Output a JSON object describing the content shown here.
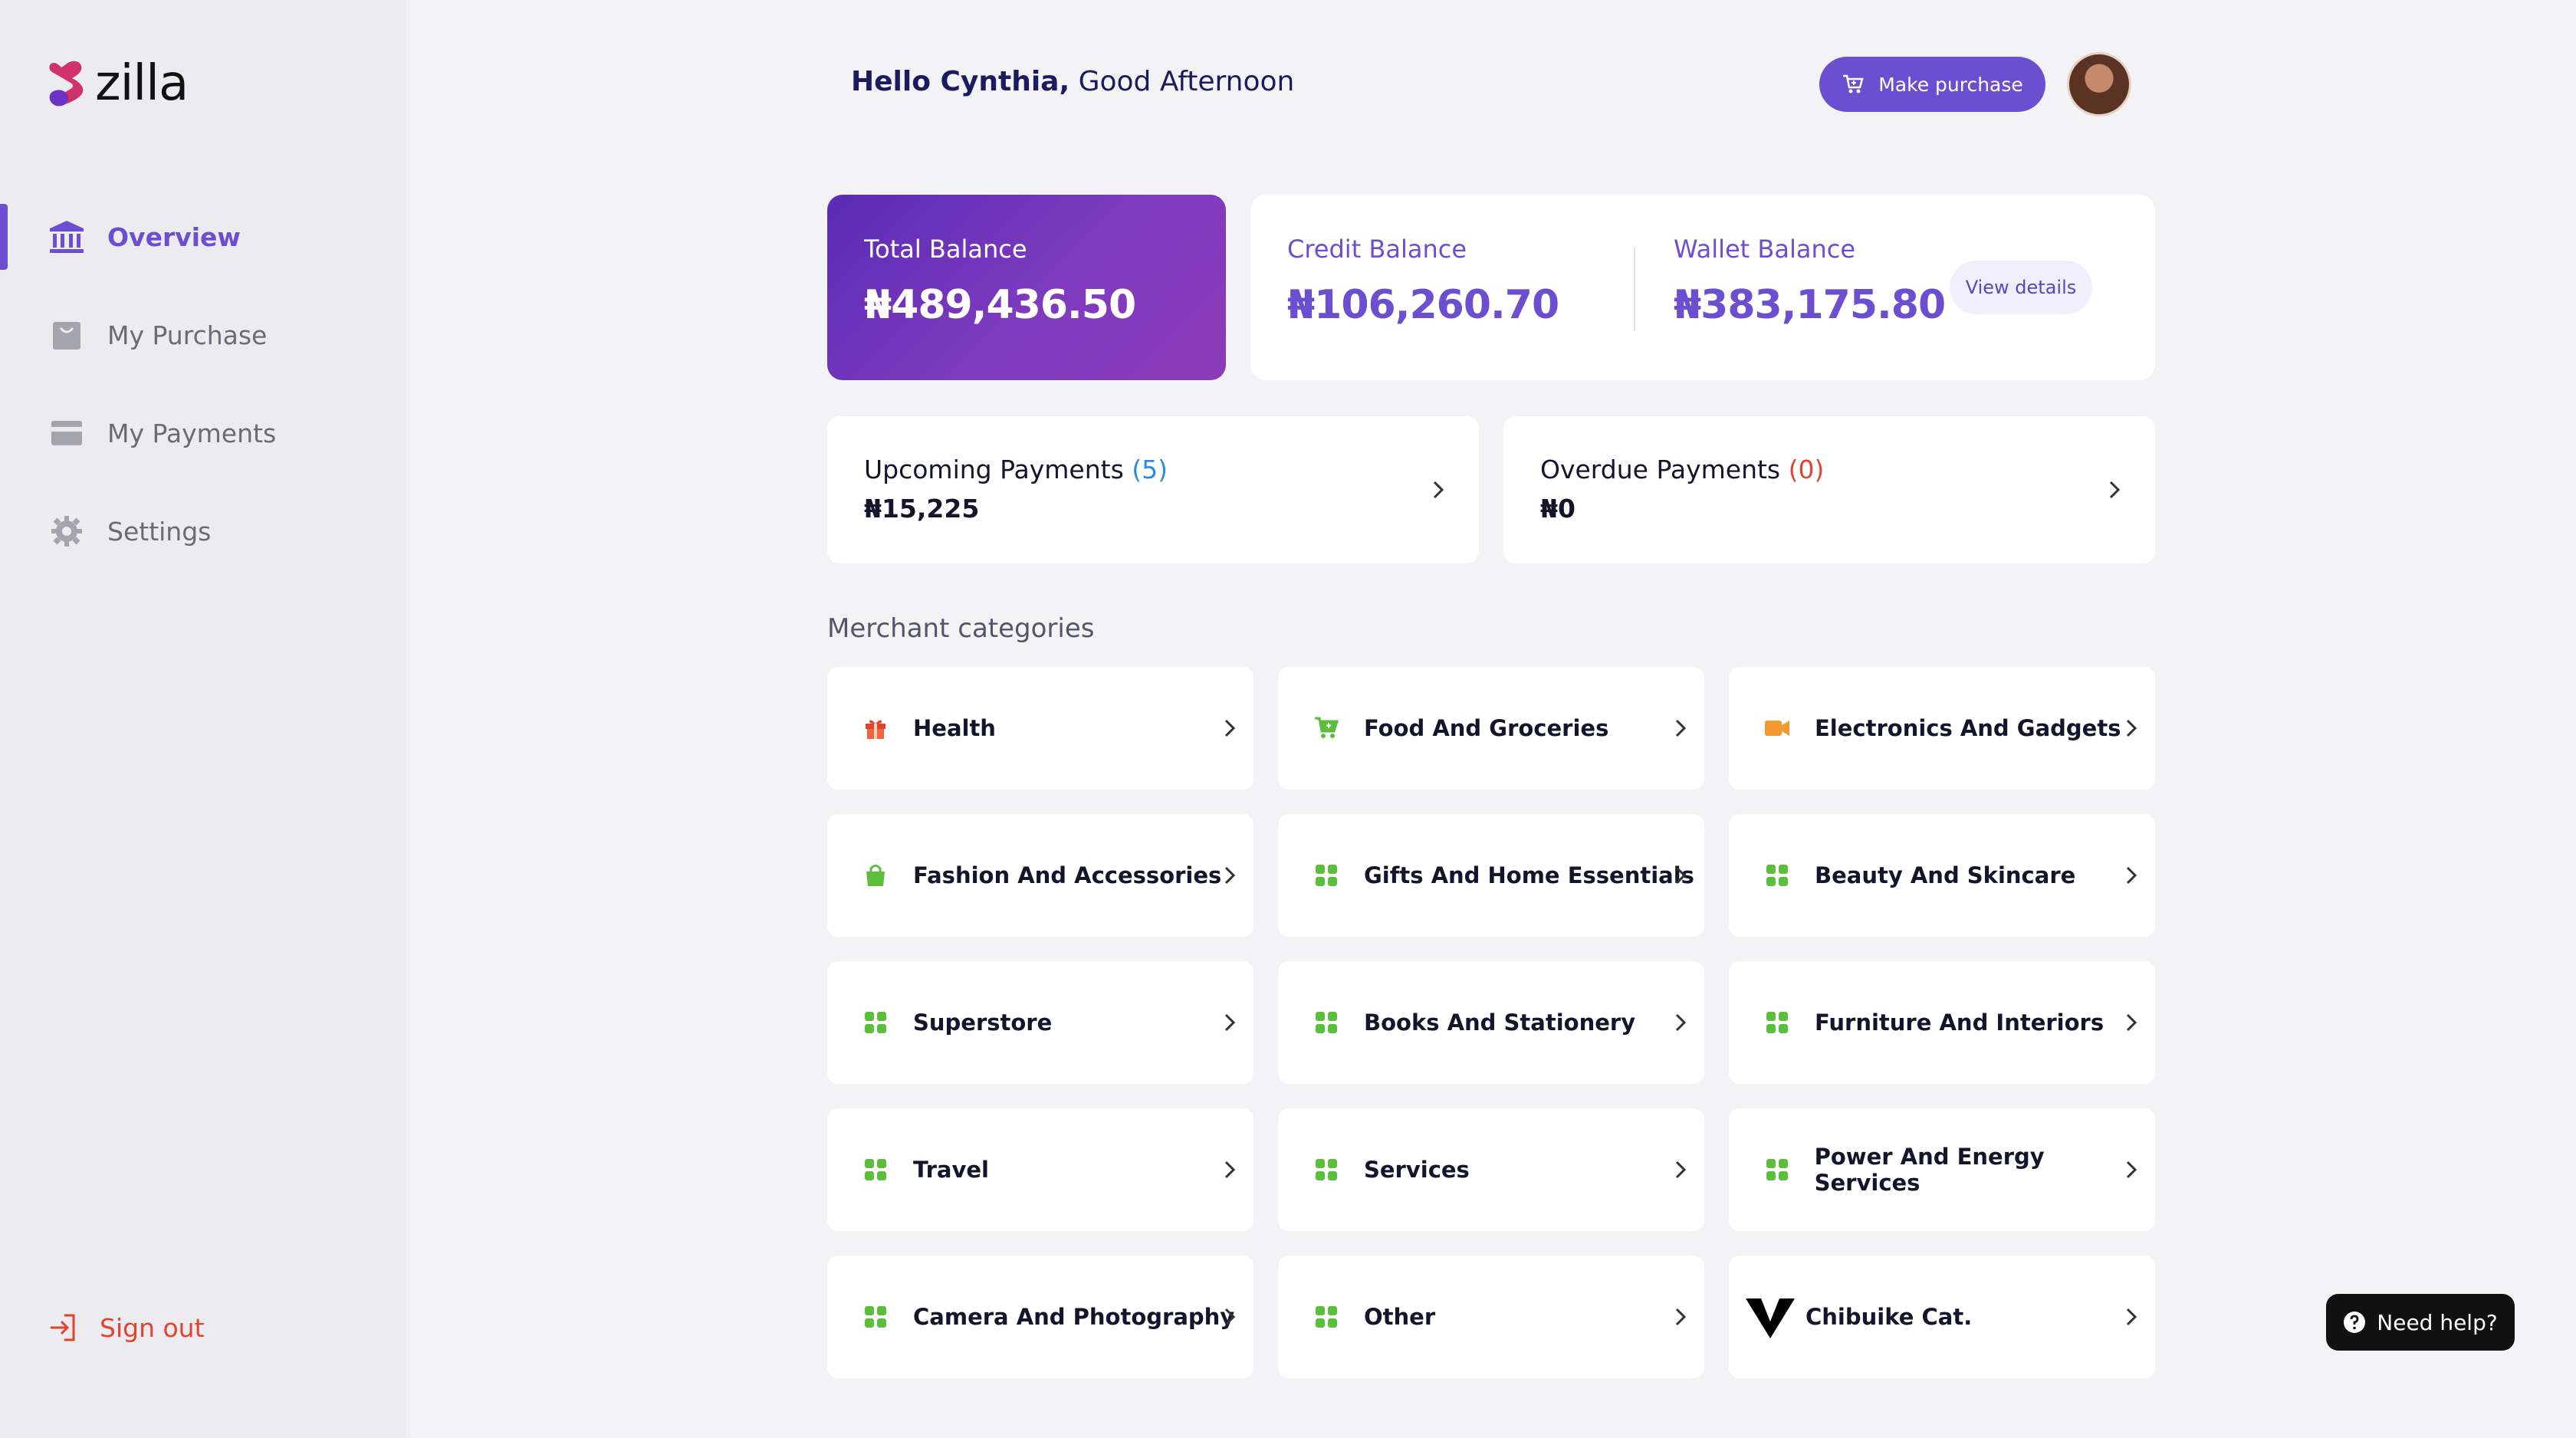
{
  "brand": {
    "name": "zilla"
  },
  "sidebar": {
    "items": [
      {
        "label": "Overview",
        "icon": "bank-icon"
      },
      {
        "label": "My Purchase",
        "icon": "bag-icon"
      },
      {
        "label": "My Payments",
        "icon": "card-icon"
      },
      {
        "label": "Settings",
        "icon": "gear-icon"
      }
    ],
    "signout": "Sign out"
  },
  "header": {
    "greeting_name": "Hello Cynthia,",
    "greeting_rest": "Good Afternoon",
    "make_purchase": "Make purchase"
  },
  "balances": {
    "total_label": "Total Balance",
    "total_value": "₦489,436.50",
    "credit_label": "Credit Balance",
    "credit_value": "₦106,260.70",
    "wallet_label": "Wallet Balance",
    "wallet_value": "₦383,175.80",
    "view_details": "View details"
  },
  "payments": {
    "upcoming_label": "Upcoming Payments",
    "upcoming_count": "(5)",
    "upcoming_amount": "₦15,225",
    "overdue_label": "Overdue Payments",
    "overdue_count": "(0)",
    "overdue_amount": "₦0"
  },
  "categories_title": "Merchant categories",
  "categories": [
    {
      "label": "Health",
      "icon": "gift-icon"
    },
    {
      "label": "Food And Groceries",
      "icon": "cart-icon"
    },
    {
      "label": "Electronics And Gadgets",
      "icon": "camera-icon"
    },
    {
      "label": "Fashion And Accessories",
      "icon": "shopping-bag-icon"
    },
    {
      "label": "Gifts And Home Essentials",
      "icon": "grid-icon"
    },
    {
      "label": "Beauty And Skincare",
      "icon": "grid-icon"
    },
    {
      "label": "Superstore",
      "icon": "grid-icon"
    },
    {
      "label": "Books And Stationery",
      "icon": "grid-icon"
    },
    {
      "label": "Furniture And Interiors",
      "icon": "grid-icon"
    },
    {
      "label": "Travel",
      "icon": "grid-icon"
    },
    {
      "label": "Services",
      "icon": "grid-icon"
    },
    {
      "label": "Power And Energy Services",
      "icon": "grid-icon"
    },
    {
      "label": "Camera And Photography",
      "icon": "grid-icon"
    },
    {
      "label": "Other",
      "icon": "grid-icon"
    },
    {
      "label": "Chibuike Cat.",
      "icon": "v-logo-icon"
    }
  ],
  "help": "Need help?",
  "colors": {
    "accent": "#6c4ed1",
    "danger": "#e1432e",
    "info": "#2a8de0",
    "category_icon": "#5cbf3c"
  }
}
